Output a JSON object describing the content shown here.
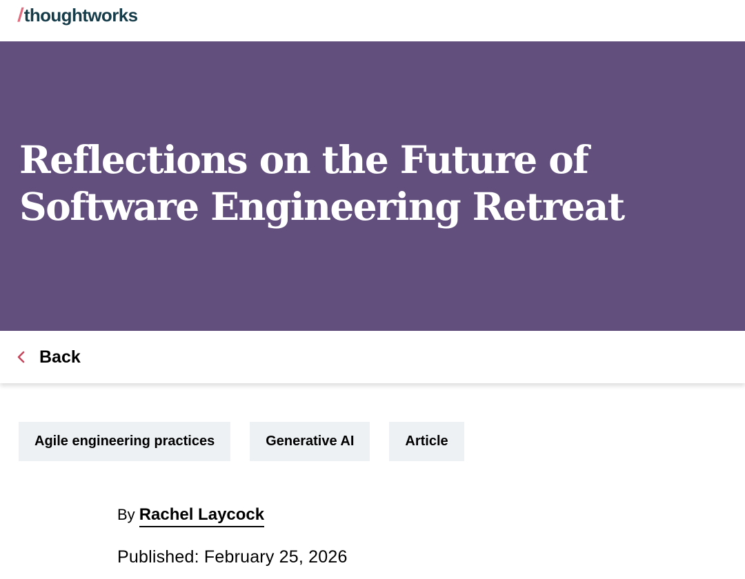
{
  "header": {
    "logo_slash": "/",
    "logo_text": "thoughtworks"
  },
  "hero": {
    "title": "Reflections on the Future of Software Engineering Retreat",
    "background_color": "#634f7d"
  },
  "navigation": {
    "back_label": "Back",
    "back_icon": "chevron-left-icon",
    "accent_color": "#c4475c"
  },
  "tags": [
    {
      "label": "Agile engineering practices"
    },
    {
      "label": "Generative AI"
    },
    {
      "label": "Article"
    }
  ],
  "byline": {
    "by_label": "By",
    "author": "Rachel Laycock"
  },
  "published": {
    "text": "Published: February 25, 2026"
  }
}
